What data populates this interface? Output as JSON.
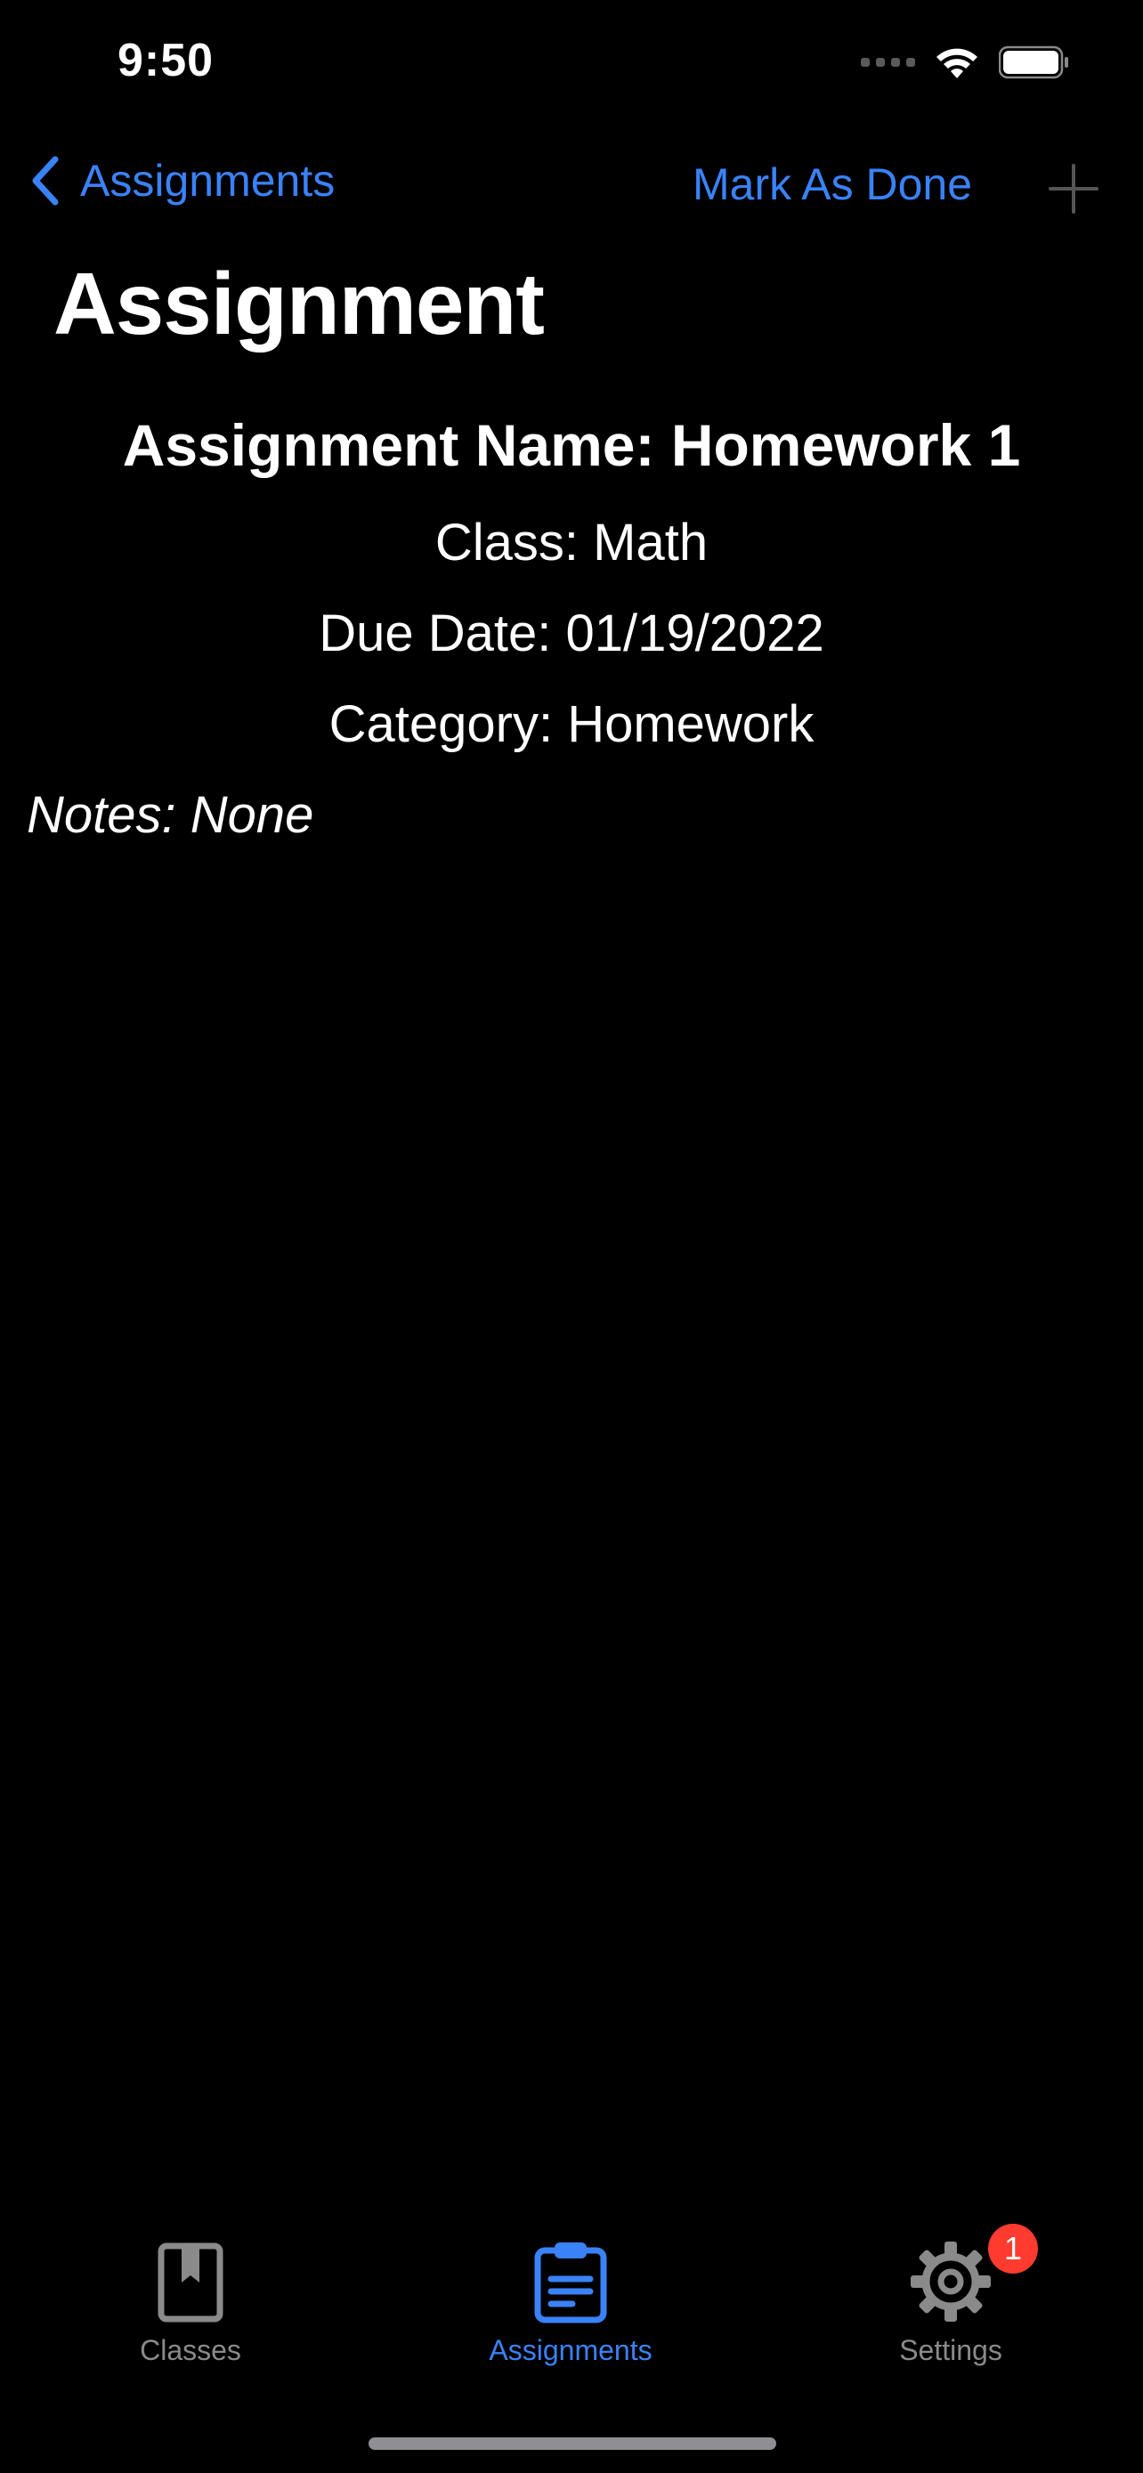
{
  "status_bar": {
    "time": "9:50"
  },
  "nav": {
    "back_label": "Assignments",
    "action_label": "Mark As Done"
  },
  "page": {
    "title": "Assignment"
  },
  "assignment": {
    "name_line": "Assignment Name: Homework 1",
    "class_line": "Class: Math",
    "due_line": "Due Date: 01/19/2022",
    "category_line": "Category: Homework",
    "notes_line": "Notes: None"
  },
  "tab_bar": {
    "tabs": [
      {
        "label": "Classes",
        "icon": "book-icon",
        "active": false
      },
      {
        "label": "Assignments",
        "icon": "clipboard-icon",
        "active": true
      },
      {
        "label": "Settings",
        "icon": "gear-icon",
        "active": false,
        "badge": "1"
      }
    ]
  },
  "colors": {
    "accent": "#3a82f7",
    "background": "#000000",
    "inactive": "#8a8a8a",
    "badge": "#ff3b30"
  }
}
